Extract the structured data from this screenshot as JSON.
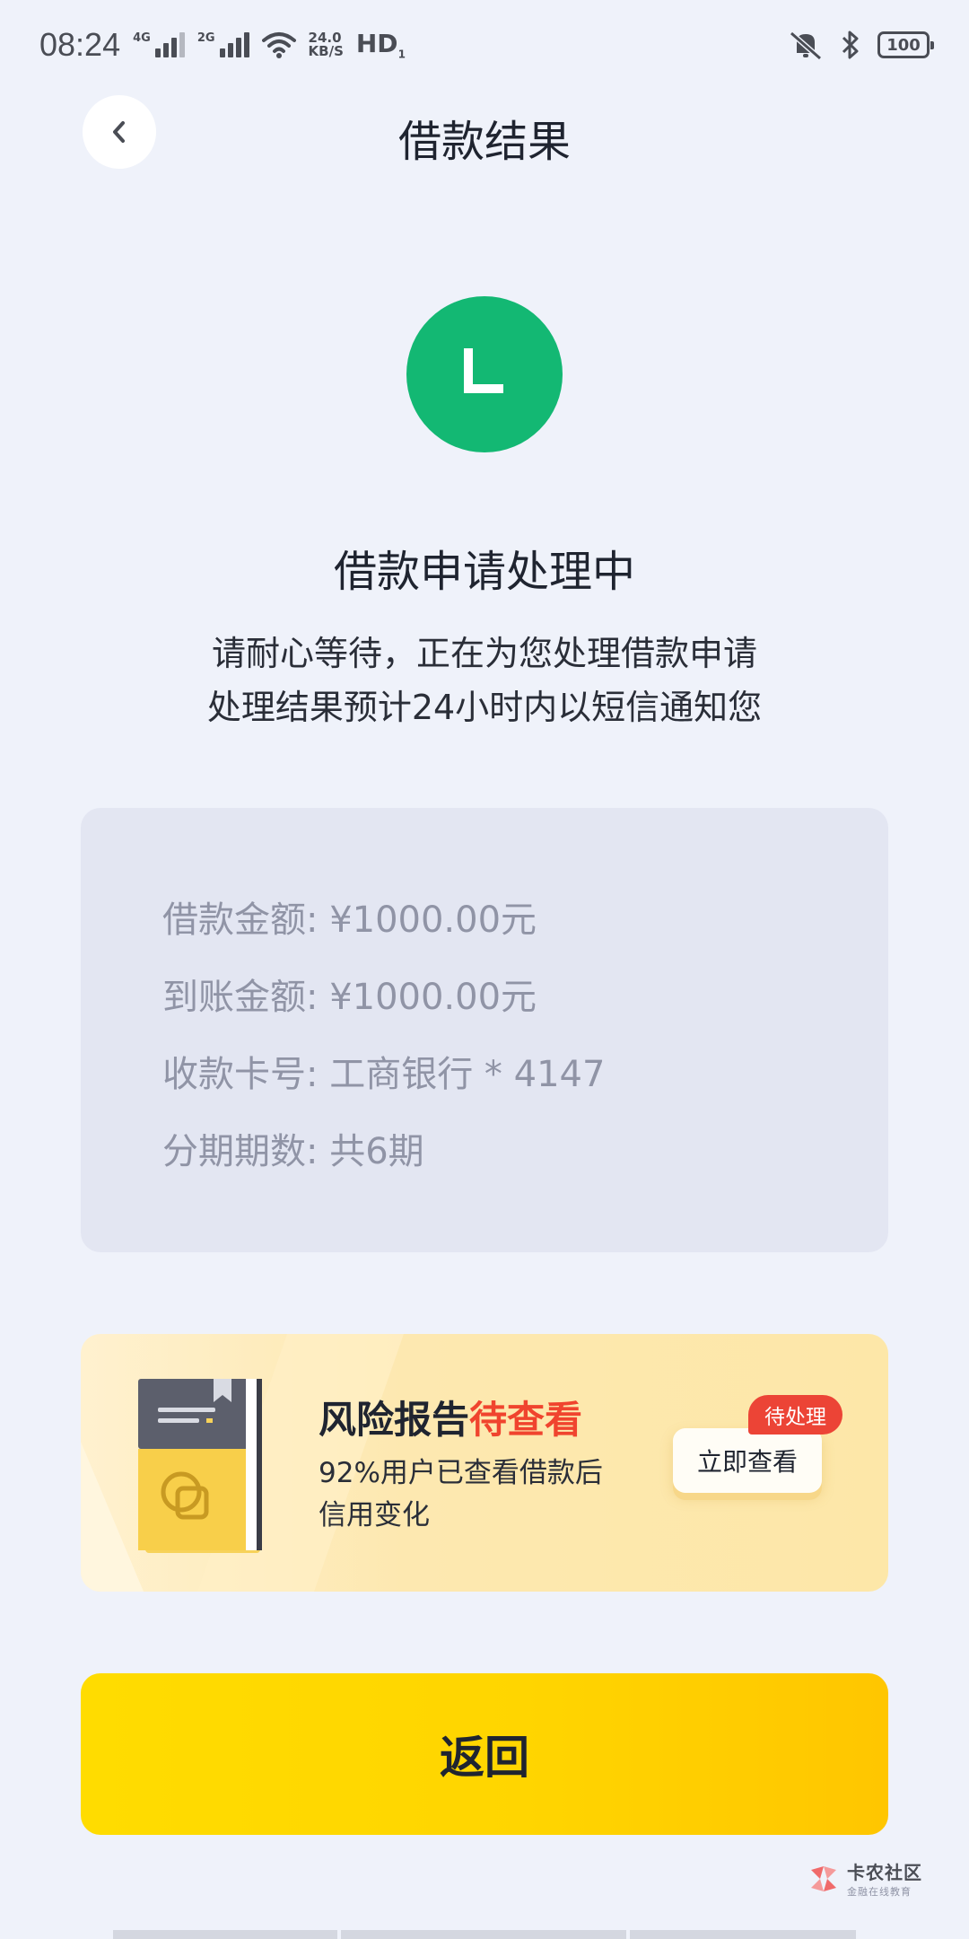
{
  "status_bar": {
    "time": "08:24",
    "net1": "4G",
    "net2": "2G",
    "speed_value": "24.0",
    "speed_unit": "KB/S",
    "hd": "HD",
    "battery": "100"
  },
  "header": {
    "title": "借款结果",
    "back_icon": "chevron-left-icon"
  },
  "result": {
    "icon_letter": "L",
    "icon_color": "#13b873",
    "title": "借款申请处理中",
    "subtitle_line1": "请耐心等待，正在为您处理借款申请",
    "subtitle_line2": "处理结果预计24小时内以短信通知您"
  },
  "info": {
    "rows": [
      "借款金额: ¥1000.00元",
      "到账金额: ¥1000.00元",
      "收款卡号: 工商银行 * 4147",
      "分期期数: 共6期"
    ]
  },
  "banner": {
    "title": "风险报告",
    "title_highlight": "待查看",
    "desc_line1": "92%用户已查看借款后",
    "desc_line2": "信用变化",
    "cta": "立即查看",
    "badge": "待处理",
    "highlight_color": "#f0442e"
  },
  "footer": {
    "return_label": "返回",
    "button_color": "#ffd500"
  },
  "watermark": {
    "main": "卡农社区",
    "sub": "金融在线教育"
  }
}
